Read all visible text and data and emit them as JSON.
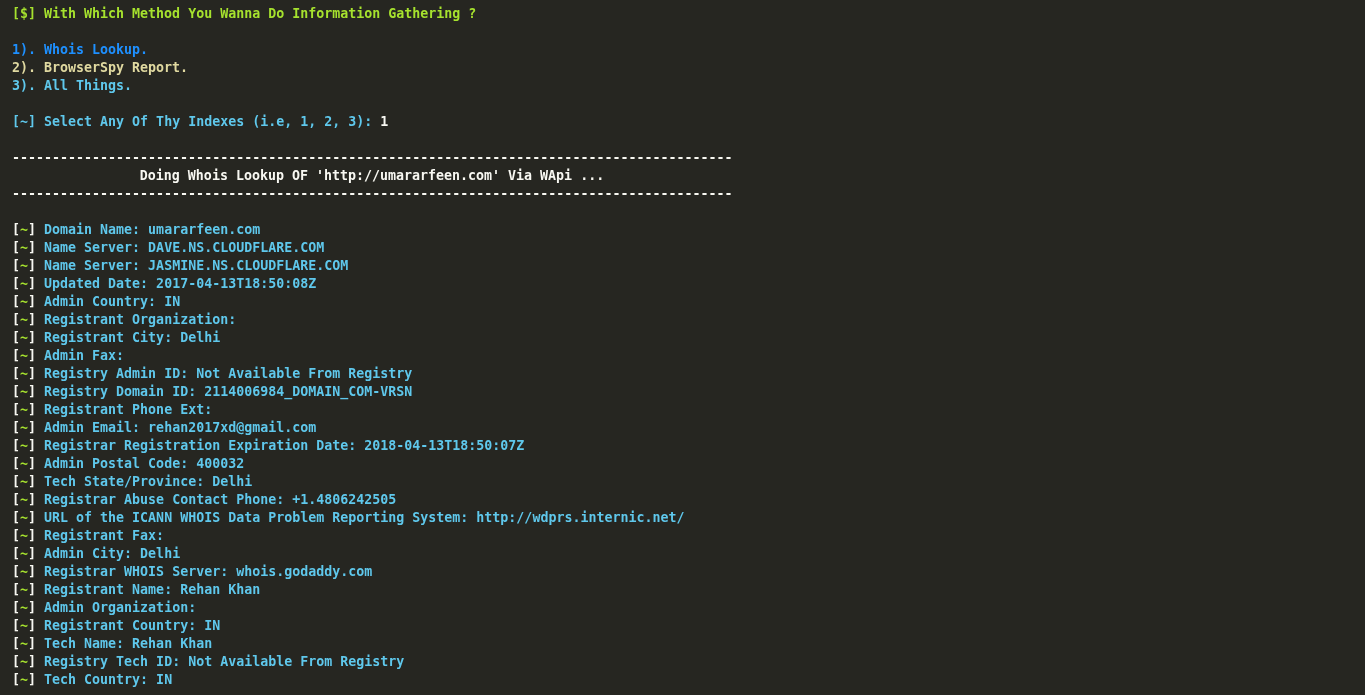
{
  "prompt": {
    "marker": "[$]",
    "text": "With Which Method You Wanna Do Information Gathering ?"
  },
  "options": [
    {
      "text": "1). Whois Lookup.",
      "color": "#1e90ff"
    },
    {
      "text": "2). BrowserSpy Report.",
      "color": "#e0d9a0"
    },
    {
      "text": "3). All Things.",
      "color": "#5fc8ec"
    }
  ],
  "select": {
    "bracket_open": "[",
    "tilde": "~",
    "bracket_close": "]",
    "label": "Select Any Of Thy Indexes (i.e, 1, 2, 3):",
    "value": "1"
  },
  "banner": {
    "rule_top": "------------------------------------------------------------------------------------------",
    "text": "Doing Whois Lookup OF 'http://umararfeen.com' Via WApi ...",
    "rule_bottom": "------------------------------------------------------------------------------------------"
  },
  "results": [
    {
      "text": "Domain Name: umararfeen.com"
    },
    {
      "text": "Name Server: DAVE.NS.CLOUDFLARE.COM"
    },
    {
      "text": "Name Server: JASMINE.NS.CLOUDFLARE.COM"
    },
    {
      "text": "Updated Date: 2017-04-13T18:50:08Z"
    },
    {
      "text": "Admin Country: IN"
    },
    {
      "text": "Registrant Organization:"
    },
    {
      "text": "Registrant City: Delhi"
    },
    {
      "text": "Admin Fax:"
    },
    {
      "text": "Registry Admin ID: Not Available From Registry"
    },
    {
      "text": "Registry Domain ID: 2114006984_DOMAIN_COM-VRSN"
    },
    {
      "text": "Registrant Phone Ext:"
    },
    {
      "text": "Admin Email: rehan2017xd@gmail.com"
    },
    {
      "text": "Registrar Registration Expiration Date: 2018-04-13T18:50:07Z"
    },
    {
      "text": "Admin Postal Code: 400032"
    },
    {
      "text": "Tech State/Province: Delhi"
    },
    {
      "text": "Registrar Abuse Contact Phone: +1.4806242505"
    },
    {
      "text": "URL of the ICANN WHOIS Data Problem Reporting System: http://wdprs.internic.net/"
    },
    {
      "text": "Registrant Fax:"
    },
    {
      "text": "Admin City: Delhi"
    },
    {
      "text": "Registrar WHOIS Server: whois.godaddy.com"
    },
    {
      "text": "Registrant Name: Rehan Khan"
    },
    {
      "text": "Admin Organization:"
    },
    {
      "text": "Registrant Country: IN"
    },
    {
      "text": "Tech Name: Rehan Khan"
    },
    {
      "text": "Registry Tech ID: Not Available From Registry"
    },
    {
      "text": "Tech Country: IN"
    }
  ]
}
